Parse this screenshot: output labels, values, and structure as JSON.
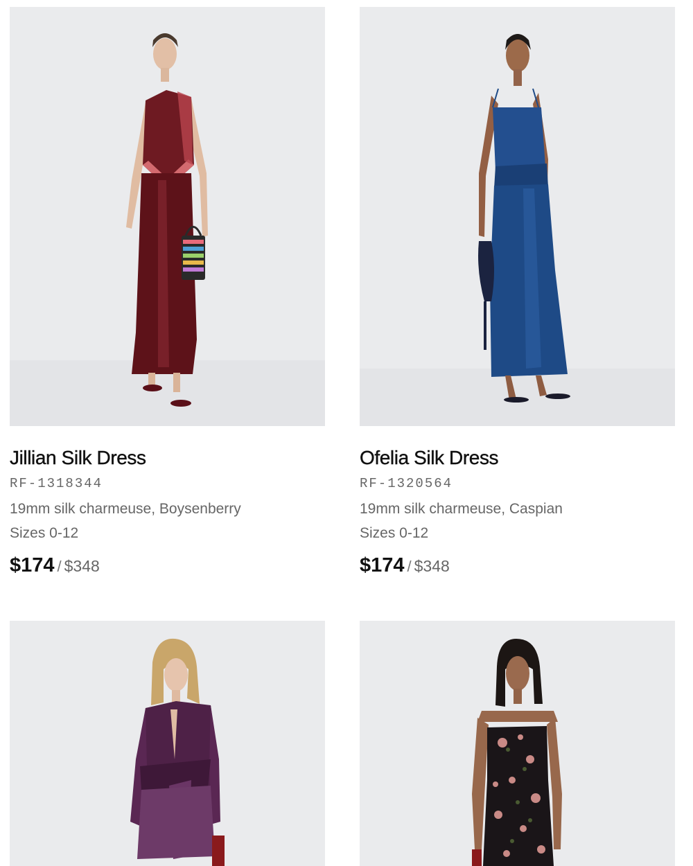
{
  "products": [
    {
      "name": "Jillian Silk Dress",
      "sku": "RF-1318344",
      "fabric": "19mm silk charmeuse, Boysenberry",
      "sizes": "Sizes 0-12",
      "sale_price": "$174",
      "separator": "/",
      "original_price": "$348",
      "image_alt": "model in burgundy silk halter dress holding striped beaded bag",
      "dress_color": "#6e1a22"
    },
    {
      "name": "Ofelia Silk Dress",
      "sku": "RF-1320564",
      "fabric": "19mm silk charmeuse, Caspian",
      "sizes": "Sizes 0-12",
      "sale_price": "$174",
      "separator": "/",
      "original_price": "$348",
      "image_alt": "model in blue silk slip dress holding beaded pouch",
      "dress_color": "#1e4a86"
    },
    {
      "image_alt": "model in plum silk wrap mini dress",
      "dress_color": "#4e2147"
    },
    {
      "image_alt": "model in black floral strapless dress",
      "dress_color": "#1a1518"
    }
  ]
}
